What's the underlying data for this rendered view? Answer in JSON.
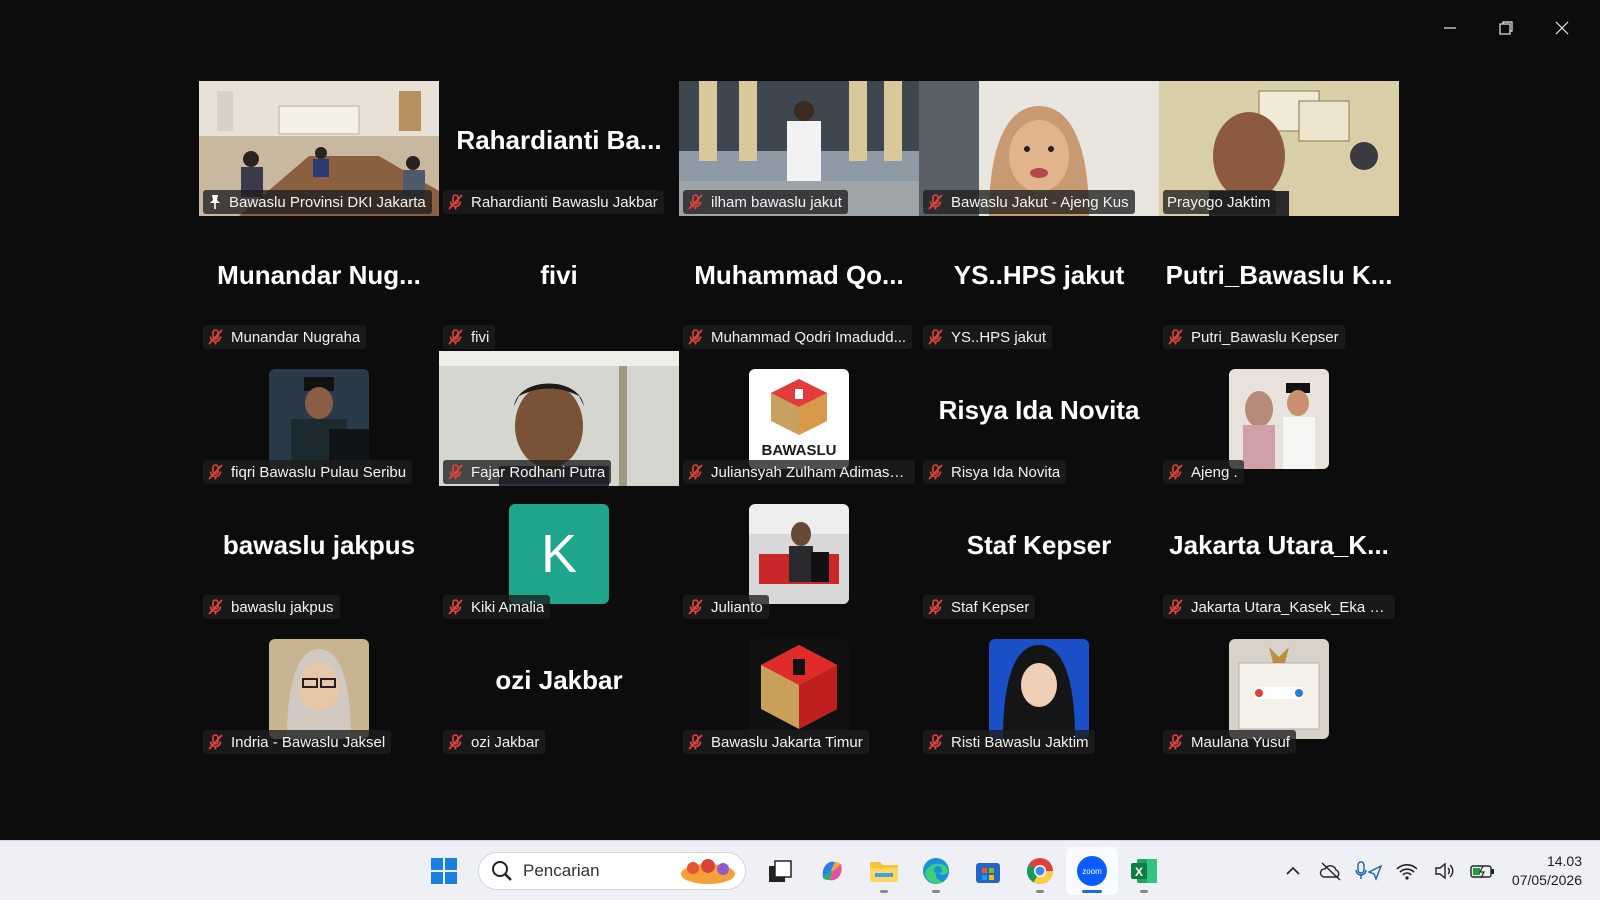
{
  "window": {
    "controls": [
      "minimize-icon",
      "restore-icon",
      "close-icon"
    ]
  },
  "participants": [
    {
      "big": "",
      "name": "Bawaslu Provinsi DKI Jakarta",
      "type": "video",
      "pinned": true,
      "active": true
    },
    {
      "big": "Rahardianti  Ba...",
      "name": "Rahardianti Bawaslu Jakbar",
      "type": "text"
    },
    {
      "big": "",
      "name": "ilham bawaslu jakut",
      "type": "video"
    },
    {
      "big": "",
      "name": "Bawaslu Jakut - Ajeng Kus",
      "type": "video"
    },
    {
      "big": "",
      "name": "Prayogo Jaktim",
      "type": "video",
      "noMic": true
    },
    {
      "big": "Munandar  Nug...",
      "name": "Munandar Nugraha",
      "type": "text"
    },
    {
      "big": "fivi",
      "name": "fivi",
      "type": "text"
    },
    {
      "big": "Muhammad  Qo...",
      "name": "Muhammad Qodri Imadudd...",
      "type": "text"
    },
    {
      "big": "YS..HPS jakut",
      "name": "YS..HPS jakut",
      "type": "text"
    },
    {
      "big": "Putri_Bawaslu  K...",
      "name": "Putri_Bawaslu Kepser",
      "type": "text"
    },
    {
      "big": "",
      "name": "fiqri Bawaslu Pulau Seribu",
      "type": "photo"
    },
    {
      "big": "",
      "name": "Fajar Rodhani Putra",
      "type": "video"
    },
    {
      "big": "",
      "name": "Juliansyah Zulham Adimasu...",
      "type": "logo",
      "logoText": "BAWASLU"
    },
    {
      "big": "Risya Ida Novita",
      "name": "Risya Ida Novita",
      "type": "text"
    },
    {
      "big": "",
      "name": "Ajeng .",
      "type": "photo"
    },
    {
      "big": "bawaslu jakpus",
      "name": "bawaslu jakpus",
      "type": "text"
    },
    {
      "big": "",
      "name": "Kiki Amalia",
      "type": "initial",
      "initial": "K"
    },
    {
      "big": "",
      "name": "Julianto",
      "type": "photo"
    },
    {
      "big": "Staf Kepser",
      "name": "Staf Kepser",
      "type": "text"
    },
    {
      "big": "Jakarta  Utara_K...",
      "name": "Jakarta Utara_Kasek_Eka Ka...",
      "type": "text"
    },
    {
      "big": "",
      "name": "Indria - Bawaslu Jaksel",
      "type": "photo"
    },
    {
      "big": "ozi Jakbar",
      "name": "ozi Jakbar",
      "type": "text"
    },
    {
      "big": "",
      "name": "Bawaslu Jakarta Timur",
      "type": "logo2"
    },
    {
      "big": "",
      "name": "Risti Bawaslu Jaktim",
      "type": "photo"
    },
    {
      "big": "",
      "name": "Maulana Yusuf",
      "type": "photo"
    }
  ],
  "colors": {
    "active_border": "#23d959",
    "mute_icon": "#e0443e",
    "avatar_k": "#1fa58c"
  },
  "taskbar": {
    "search_placeholder": "Pencarian",
    "apps": [
      "windows-start-icon",
      "task-view-icon",
      "copilot-icon",
      "file-explorer-icon",
      "edge-icon",
      "store-icon",
      "chrome-icon",
      "zoom-icon",
      "excel-icon"
    ],
    "zoom_label": "zoom",
    "excel_label": "X",
    "tray": [
      "chevron-up-icon",
      "onedrive-off-icon",
      "mic-location-icon",
      "wifi-icon",
      "volume-icon",
      "battery-icon"
    ],
    "time": "14.03",
    "date": "07/05/2026"
  }
}
